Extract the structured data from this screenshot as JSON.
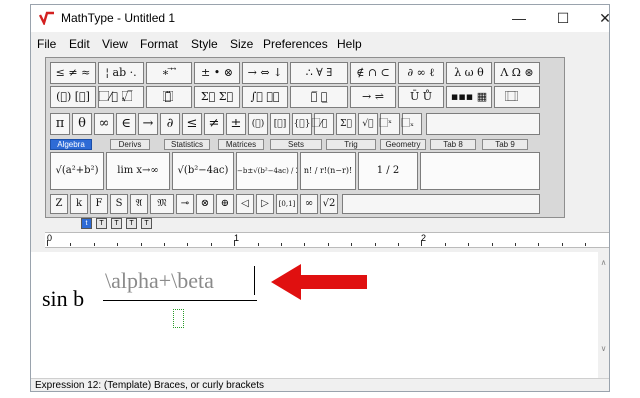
{
  "window": {
    "title": "MathType - Untitled 1",
    "minimize_glyph": "—",
    "maximize_glyph": "☐",
    "close_glyph": "✕",
    "logo_color": "#d32020"
  },
  "menubar": {
    "items": [
      {
        "key": "F",
        "rest": "ile"
      },
      {
        "key": "E",
        "rest": "dit"
      },
      {
        "key": "V",
        "rest": "iew"
      },
      {
        "key": "",
        "pre": "For",
        "key2": "m",
        "rest": "at"
      },
      {
        "key": "S",
        "rest": "tyle"
      },
      {
        "key": "",
        "pre": "Si",
        "key2": "z",
        "rest": "e"
      },
      {
        "key": "P",
        "rest": "references"
      },
      {
        "key": "H",
        "rest": "elp"
      }
    ],
    "labels": [
      "File",
      "Edit",
      "View",
      "Format",
      "Style",
      "Size",
      "Preferences",
      "Help"
    ]
  },
  "palette": {
    "row1": [
      "≤ ≠ ≈",
      "¦ ab ·.",
      "∗ ⃗ ⃗",
      "± • ⊗",
      "→ ⇔ ↓",
      "∴ ∀ ∃",
      "∉ ∩ ⊂",
      "∂ ∞ ℓ",
      "λ ω θ",
      "Λ Ω ⊛"
    ],
    "row2": [
      "(⃞) [⃞]",
      "⃞⁄⃞ √⃞",
      "⃞̈ ⃞",
      "Σ⃞ Σ⃞",
      "∫⃞ ∮⃞",
      "⃞̅ ⃞̲",
      "→ ⇌",
      "Ū Ů",
      "▪▪▪ ▦",
      "⃞ ⃞"
    ],
    "row3": [
      "π",
      "θ",
      "∞",
      "∈",
      "→",
      "∂",
      "≤",
      "≠",
      "±",
      "(⃞)",
      "[⃞]",
      "{⃞}",
      "⃞⁄⃞",
      "Σ⃞",
      "√⃞",
      "⃞ˣ",
      "⃞ₓ"
    ],
    "tabs": [
      "Algebra",
      "Derivs",
      "Statistics",
      "Matrices",
      "Sets",
      "Trig",
      "Geometry",
      "Tab 8",
      "Tab 9"
    ],
    "active_tab": "Algebra",
    "templates": [
      "√(a²+b²)",
      "lim x→∞",
      "√(b²−4ac)",
      "−b±√(b²−4ac) / 2a",
      "n! / r!(n−r)!",
      "1 / 2"
    ],
    "row5": [
      "Z",
      "k",
      "F",
      "S",
      "𝔄",
      "𝔐",
      "⊸",
      "⊗",
      "⊕",
      "◁",
      "▷",
      "[0,1]",
      "∞",
      "√2"
    ]
  },
  "size_bar": {
    "buttons": [
      "t",
      "T",
      "T",
      "T",
      "T"
    ]
  },
  "ruler": {
    "labels": [
      "0",
      "1",
      "2"
    ]
  },
  "editor": {
    "sin_text": "sin b",
    "numerator_text": "\\alpha+\\beta",
    "arrow_color": "#e01010"
  },
  "scroll": {
    "up_glyph": "∧",
    "down_glyph": "∨"
  },
  "status": {
    "text": "Expression 12: (Template) Braces, or curly brackets"
  }
}
